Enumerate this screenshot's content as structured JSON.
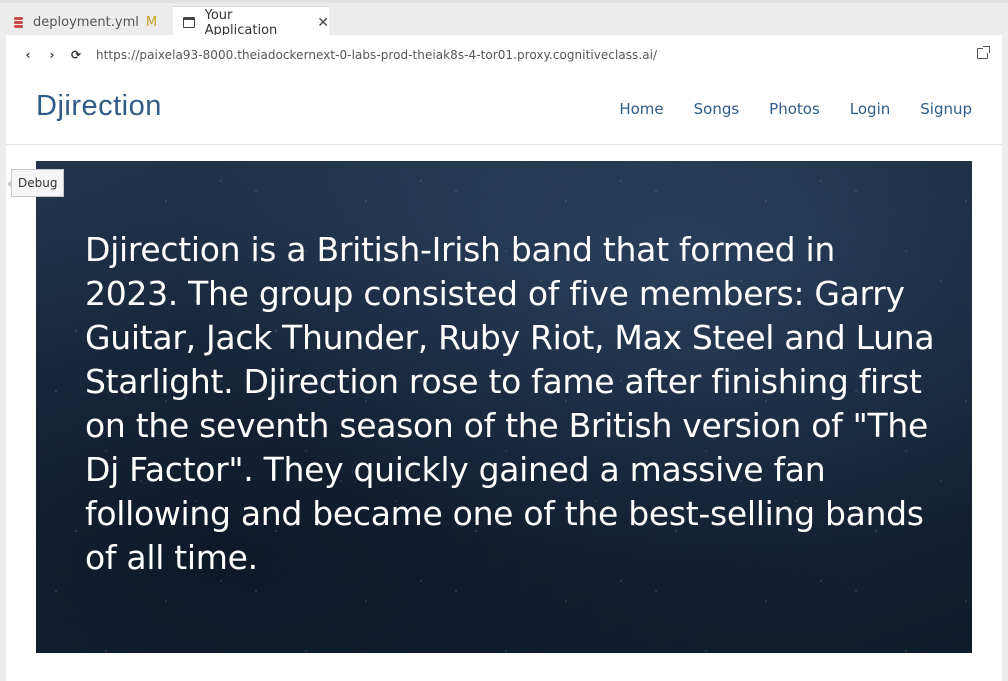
{
  "tabs": [
    {
      "label": "deployment.yml",
      "badge": "M"
    },
    {
      "label": "Your Application",
      "close": "✕"
    }
  ],
  "browser": {
    "back": "‹",
    "forward": "›",
    "reload": "⟳",
    "url": "https://paixela93-8000.theiadockernext-0-labs-prod-theiak8s-4-tor01.proxy.cognitiveclass.ai/"
  },
  "site": {
    "brand": "Djirection",
    "nav": [
      "Home",
      "Songs",
      "Photos",
      "Login",
      "Signup"
    ]
  },
  "debug_label": "Debug",
  "hero": {
    "text": "Djirection is a British-Irish band that formed in 2023. The group consisted of five members: Garry Guitar, Jack Thunder, Ruby Riot, Max Steel and Luna Starlight. Djirection rose to fame after finishing first on the seventh season of the British version of \"The Dj Factor\". They quickly gained a massive fan following and became one of the best-selling bands of all time."
  },
  "icons": {
    "tab1": "database-icon",
    "tab2": "window-icon",
    "external": "external-link-icon"
  },
  "colors": {
    "brand": "#2f5c86",
    "modified": "#c9a227",
    "hero_bg": "#17283d"
  }
}
